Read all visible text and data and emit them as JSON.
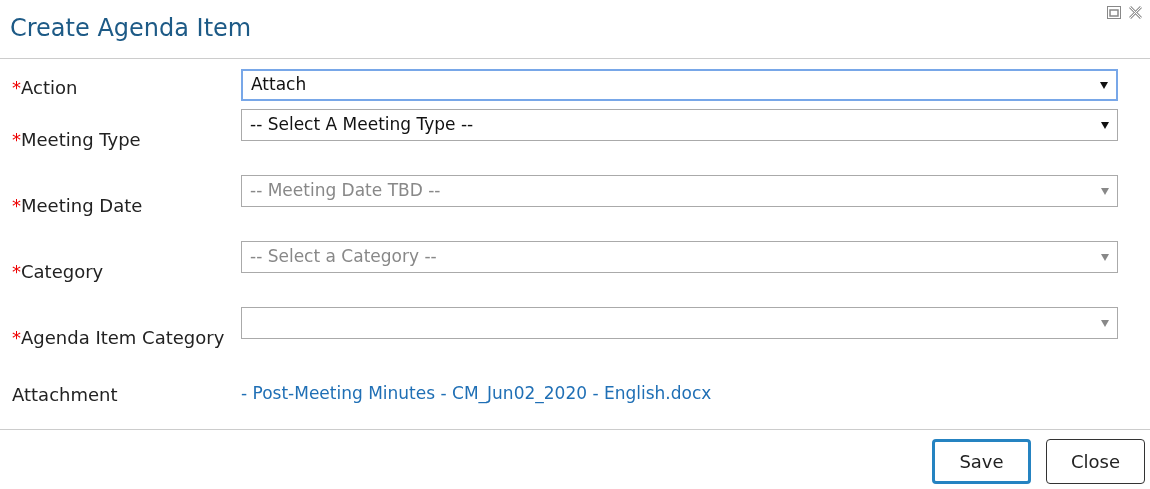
{
  "dialog": {
    "title": "Create Agenda Item"
  },
  "fields": [
    {
      "label": "Action",
      "required_mark": "*",
      "kind": "select",
      "value": "Attach",
      "focused": true,
      "disabled": false
    },
    {
      "label": "Meeting Type",
      "required_mark": "*",
      "kind": "select",
      "value": "-- Select A Meeting Type --",
      "focused": false,
      "disabled": false
    },
    {
      "label": "Meeting Date",
      "required_mark": "*",
      "kind": "select",
      "value": "-- Meeting Date TBD --",
      "focused": false,
      "disabled": true
    },
    {
      "label": "Category",
      "required_mark": "*",
      "kind": "select",
      "value": "-- Select a Category --",
      "focused": false,
      "disabled": true
    },
    {
      "label": "Agenda Item Category",
      "required_mark": "*",
      "kind": "select",
      "focused": false,
      "disabled": true
    },
    {
      "label": "Attachment",
      "kind": "link",
      "value": "- Post-Meeting Minutes - CM_Jun02_2020 - English.docx"
    }
  ],
  "buttons": [
    {
      "label": "Save",
      "focused": true
    },
    {
      "label": "Close",
      "focused": false
    }
  ]
}
